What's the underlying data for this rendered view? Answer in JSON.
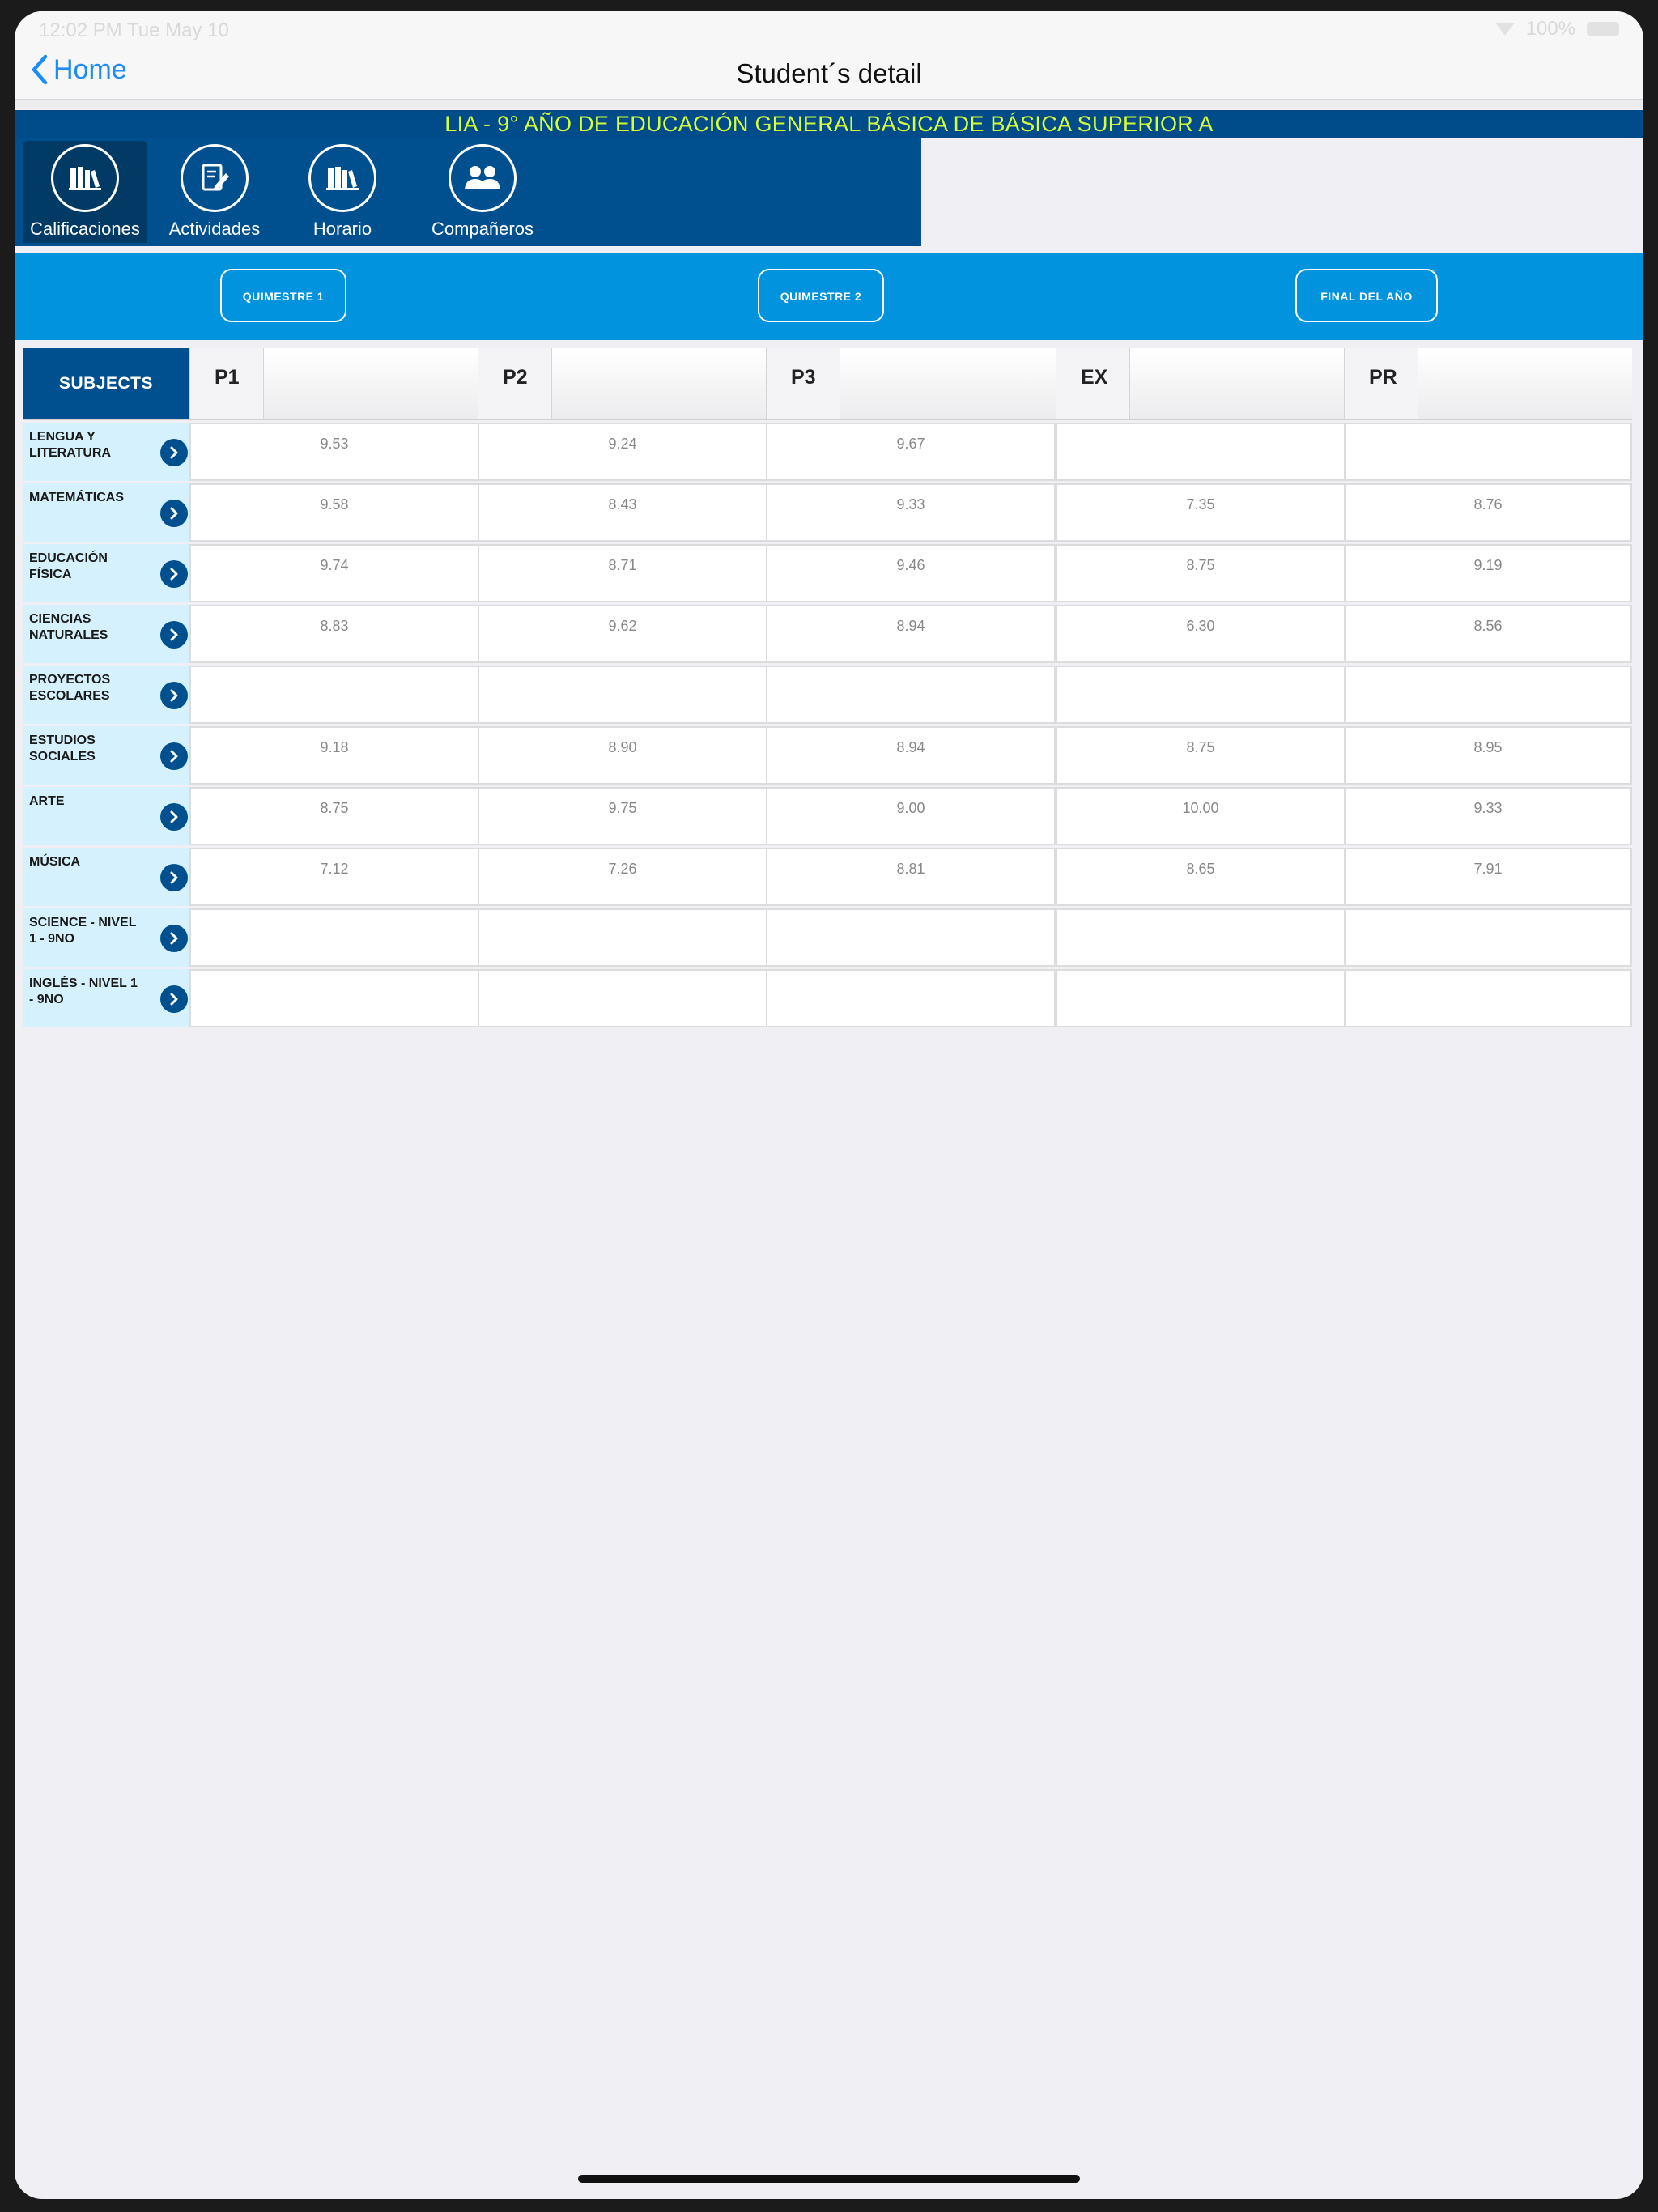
{
  "status_bar": {
    "left": "12:02 PM   Tue May 10",
    "right": "100%"
  },
  "nav": {
    "back_label": "Home",
    "title": "Student´s detail"
  },
  "banner": {
    "text": "LIA - 9° AÑO DE EDUCACIÓN GENERAL BÁSICA DE BÁSICA SUPERIOR A",
    "color": "#d6ff3a"
  },
  "toolbar": {
    "items": [
      {
        "label": "Calificaciones",
        "icon": "books-icon",
        "active": true
      },
      {
        "label": "Actividades",
        "icon": "edit-icon",
        "active": false
      },
      {
        "label": "Horario",
        "icon": "schedule-icon",
        "active": false
      },
      {
        "label": "Compañeros",
        "icon": "classmates-icon",
        "active": false
      }
    ]
  },
  "terms": [
    "QUIMESTRE 1",
    "QUIMESTRE 2",
    "FINAL DEL AÑO"
  ],
  "grades": {
    "subjects_header": "SUBJECTS",
    "columns": [
      "P1",
      "P2",
      "P3",
      "EX",
      "PR"
    ],
    "rows": [
      {
        "subject": "LENGUA Y LITERATURA",
        "values": [
          "9.53",
          "9.24",
          "9.67",
          "",
          ""
        ]
      },
      {
        "subject": "MATEMÁTICAS",
        "values": [
          "9.58",
          "8.43",
          "9.33",
          "7.35",
          "8.76"
        ]
      },
      {
        "subject": "EDUCACIÓN FÍSICA",
        "values": [
          "9.74",
          "8.71",
          "9.46",
          "8.75",
          "9.19"
        ]
      },
      {
        "subject": "CIENCIAS NATURALES",
        "values": [
          "8.83",
          "9.62",
          "8.94",
          "6.30",
          "8.56"
        ]
      },
      {
        "subject": "PROYECTOS ESCOLARES",
        "values": [
          "",
          "",
          "",
          "",
          ""
        ]
      },
      {
        "subject": "ESTUDIOS SOCIALES",
        "values": [
          "9.18",
          "8.90",
          "8.94",
          "8.75",
          "8.95"
        ]
      },
      {
        "subject": "ARTE",
        "values": [
          "8.75",
          "9.75",
          "9.00",
          "10.00",
          "9.33"
        ]
      },
      {
        "subject": "MÚSICA",
        "values": [
          "7.12",
          "7.26",
          "8.81",
          "8.65",
          "7.91"
        ]
      },
      {
        "subject": "SCIENCE - NIVEL 1 - 9no",
        "values": [
          "",
          "",
          "",
          "",
          ""
        ]
      },
      {
        "subject": "INGLÉS - NIVEL 1 - 9no",
        "values": [
          "",
          "",
          "",
          "",
          ""
        ]
      }
    ]
  }
}
